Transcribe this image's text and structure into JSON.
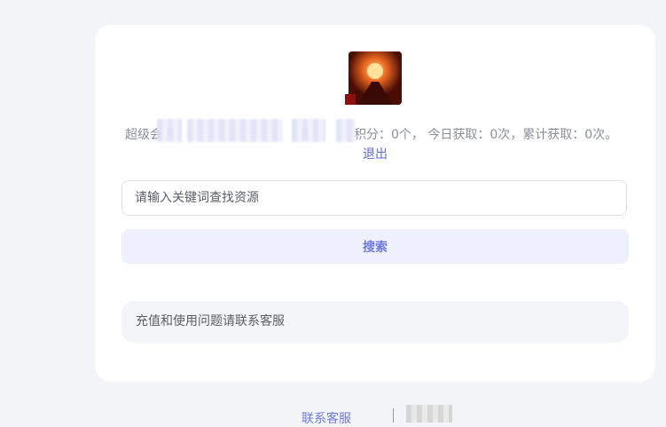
{
  "user": {
    "level_prefix": "超级会",
    "stats_text": "积分：0个，  今日获取：0次，累计获取：0次。",
    "logout_label": "退出"
  },
  "search": {
    "placeholder": "请输入关键词查找资源",
    "value": "",
    "button_label": "搜索"
  },
  "notice": {
    "text": "充值和使用问题请联系客服"
  },
  "footer": {
    "contact_label": "联系客服"
  },
  "colors": {
    "accent": "#6f7ae0",
    "page_bg": "#f3f4f7"
  }
}
